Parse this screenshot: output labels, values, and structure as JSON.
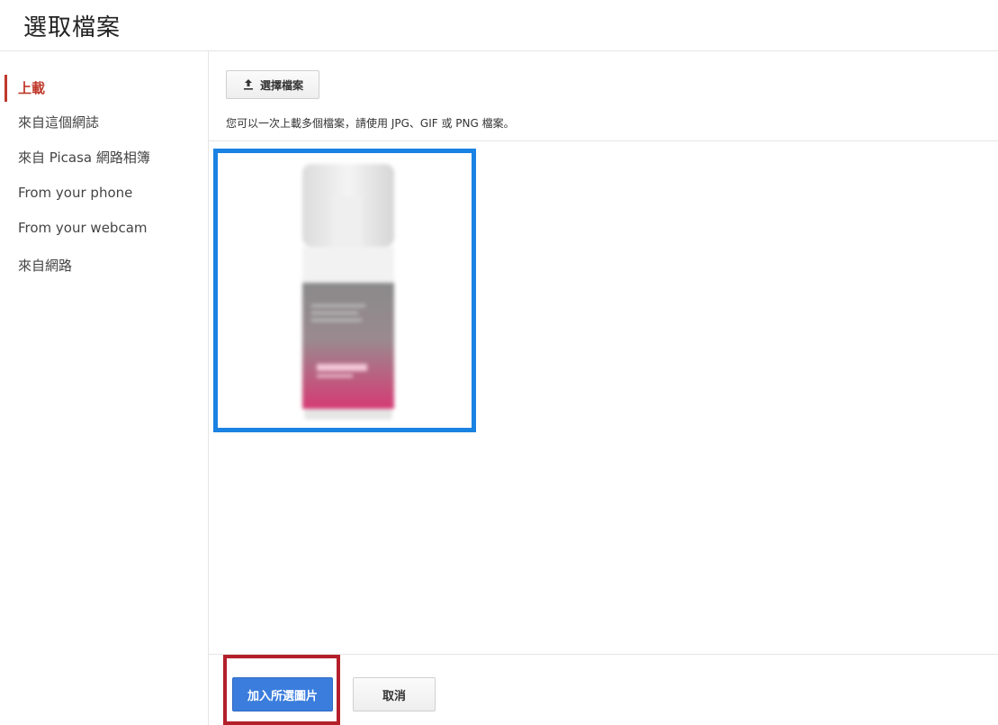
{
  "dialog": {
    "title": "選取檔案"
  },
  "sidebar": {
    "items": [
      {
        "label": "上載",
        "active": true
      },
      {
        "label": "來自這個網誌",
        "active": false
      },
      {
        "label": "來自 Picasa 網路相簿",
        "active": false
      },
      {
        "label": "From your phone",
        "active": false
      },
      {
        "label": "From your webcam",
        "active": false
      },
      {
        "label": "來自網路",
        "active": false
      }
    ]
  },
  "upload": {
    "choose_button_label": "選擇檔案",
    "choose_button_icon": "upload-icon",
    "hint": "您可以一次上載多個檔案，請使用 JPG、GIF 或 PNG 檔案。"
  },
  "selection": {
    "highlight_color": "#1a82e2",
    "selected": true
  },
  "footer": {
    "add_button_label": "加入所選圖片",
    "cancel_button_label": "取消",
    "annotation_color": "#b3202a"
  },
  "colors": {
    "active_nav": "#c0392b",
    "primary_button": "#3b7ddd"
  }
}
